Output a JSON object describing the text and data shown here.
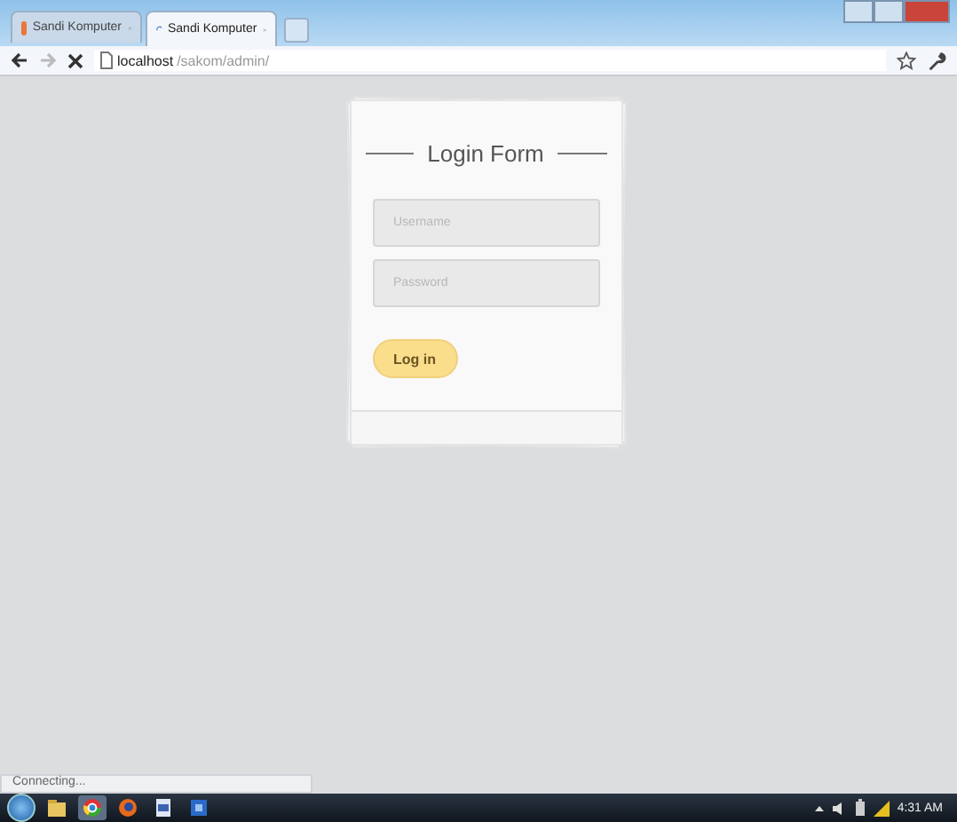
{
  "tabs": [
    {
      "title": "Sandi Komputer",
      "selected": false,
      "loading": false
    },
    {
      "title": "Sandi Komputer",
      "selected": true,
      "loading": true
    }
  ],
  "address": {
    "host": "localhost",
    "path": "/sakom/admin/"
  },
  "form": {
    "title": "Login Form",
    "fields": [
      {
        "placeholder": "Username"
      },
      {
        "placeholder": "Password"
      }
    ],
    "button": "Log in"
  },
  "status_bar": "Connecting...",
  "taskbar": {
    "time": "4:31 AM"
  }
}
